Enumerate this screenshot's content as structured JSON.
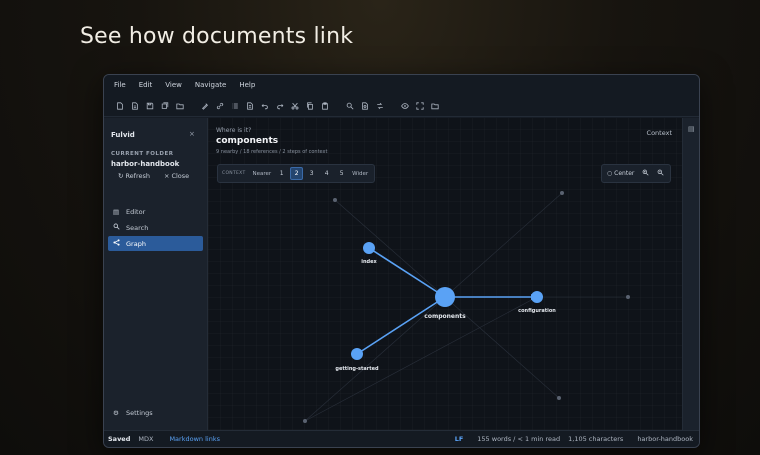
{
  "headline": "See how documents link",
  "menu": [
    "File",
    "Edit",
    "View",
    "Navigate",
    "Help"
  ],
  "sidebar": {
    "title": "Fulvid",
    "close": "×",
    "folder_label": "CURRENT FOLDER",
    "folder_name": "harbor-handbook",
    "refresh": "Refresh",
    "close_folder": "Close",
    "nav": [
      {
        "label": "Editor",
        "icon": "editor-icon"
      },
      {
        "label": "Search",
        "icon": "search-icon"
      },
      {
        "label": "Graph",
        "icon": "graph-icon",
        "active": true
      }
    ],
    "settings": "Settings"
  },
  "main": {
    "question": "Where is it?",
    "title": "components",
    "subtitle": "9 nearby / 18 references / 2 steps of context",
    "context_label": "Context",
    "depth": {
      "label": "CONTEXT",
      "nearer": "Nearer",
      "levels": [
        "1",
        "2",
        "3",
        "4",
        "5"
      ],
      "selected": "2",
      "wider": "Wider"
    },
    "center": "Center"
  },
  "graph": {
    "nodes": [
      {
        "id": "components",
        "label": "components",
        "main": true
      },
      {
        "id": "index",
        "label": "index"
      },
      {
        "id": "configuration",
        "label": "configuration"
      },
      {
        "id": "getting-started",
        "label": "getting-started"
      }
    ],
    "accent": "#5aa2f5"
  },
  "status": {
    "saved": "Saved",
    "mode": "MDX",
    "links": "Markdown links",
    "eol": "LF",
    "words": "155 words / < 1 min read",
    "chars": "1,105 characters",
    "folder": "harbor-handbook"
  }
}
